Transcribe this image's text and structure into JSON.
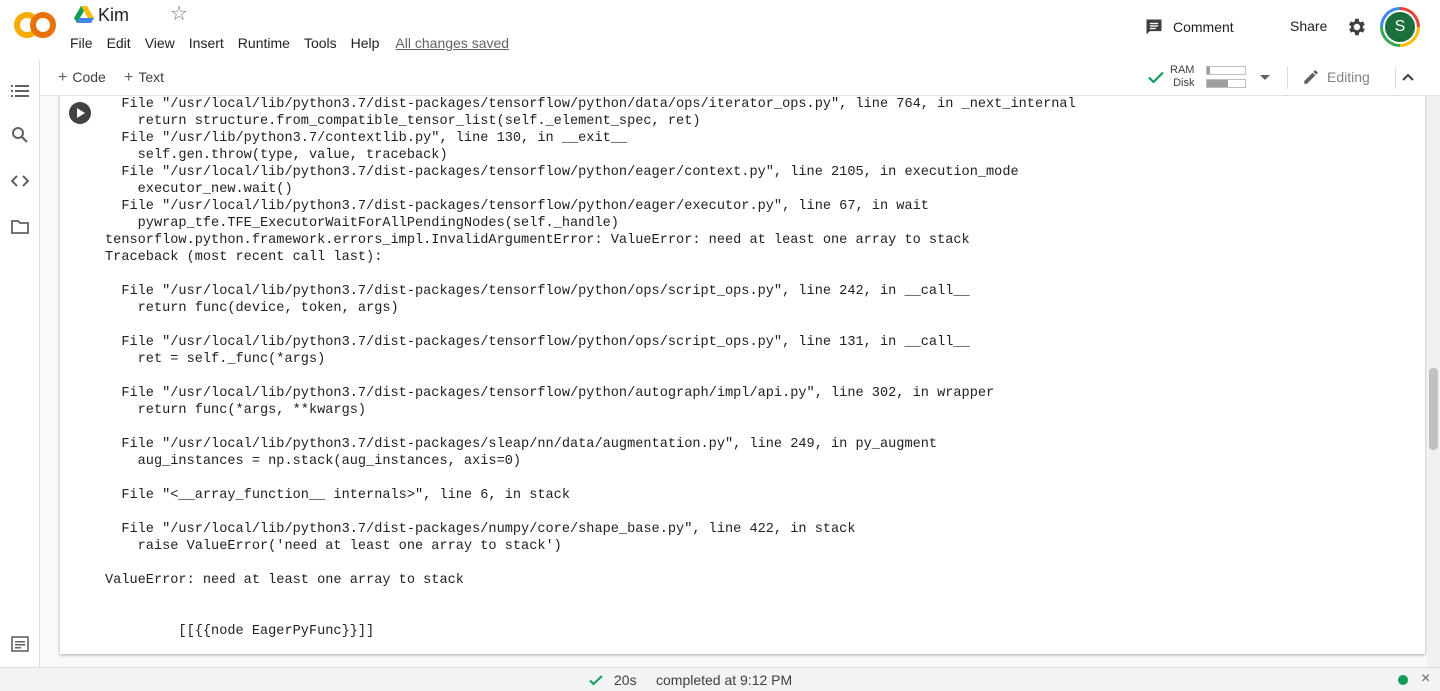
{
  "header": {
    "title": "Kim",
    "menu": [
      "File",
      "Edit",
      "View",
      "Insert",
      "Runtime",
      "Tools",
      "Help"
    ],
    "save_status": "All changes saved",
    "comment_label": "Comment",
    "share_label": "Share",
    "avatar_letter": "S",
    "logo_text": "CO",
    "colors": {
      "logo_orange": "#f9ab00",
      "logo_dark_orange": "#e8710a",
      "avatar_bg": "#1b6f3d"
    }
  },
  "toolbar": {
    "add_code_label": "Code",
    "add_text_label": "Text",
    "ram_label": "RAM",
    "disk_label": "Disk",
    "ram_usage": 0.08,
    "disk_usage": 0.55,
    "editing_label": "Editing"
  },
  "cell": {
    "output_lines": [
      "  File \"/usr/local/lib/python3.7/dist-packages/tensorflow/python/data/ops/iterator_ops.py\", line 764, in _next_internal",
      "    return structure.from_compatible_tensor_list(self._element_spec, ret)",
      "  File \"/usr/lib/python3.7/contextlib.py\", line 130, in __exit__",
      "    self.gen.throw(type, value, traceback)",
      "  File \"/usr/local/lib/python3.7/dist-packages/tensorflow/python/eager/context.py\", line 2105, in execution_mode",
      "    executor_new.wait()",
      "  File \"/usr/local/lib/python3.7/dist-packages/tensorflow/python/eager/executor.py\", line 67, in wait",
      "    pywrap_tfe.TFE_ExecutorWaitForAllPendingNodes(self._handle)",
      "tensorflow.python.framework.errors_impl.InvalidArgumentError: ValueError: need at least one array to stack",
      "Traceback (most recent call last):",
      "",
      "  File \"/usr/local/lib/python3.7/dist-packages/tensorflow/python/ops/script_ops.py\", line 242, in __call__",
      "    return func(device, token, args)",
      "",
      "  File \"/usr/local/lib/python3.7/dist-packages/tensorflow/python/ops/script_ops.py\", line 131, in __call__",
      "    ret = self._func(*args)",
      "",
      "  File \"/usr/local/lib/python3.7/dist-packages/tensorflow/python/autograph/impl/api.py\", line 302, in wrapper",
      "    return func(*args, **kwargs)",
      "",
      "  File \"/usr/local/lib/python3.7/dist-packages/sleap/nn/data/augmentation.py\", line 249, in py_augment",
      "    aug_instances = np.stack(aug_instances, axis=0)",
      "",
      "  File \"<__array_function__ internals>\", line 6, in stack",
      "",
      "  File \"/usr/local/lib/python3.7/dist-packages/numpy/core/shape_base.py\", line 422, in stack",
      "    raise ValueError('need at least one array to stack')",
      "",
      "ValueError: need at least one array to stack",
      "",
      "",
      "         [[{{node EagerPyFunc}}]]"
    ]
  },
  "statusbar": {
    "duration": "20s",
    "completed": "completed at 9:12 PM",
    "close_glyph": "×"
  }
}
